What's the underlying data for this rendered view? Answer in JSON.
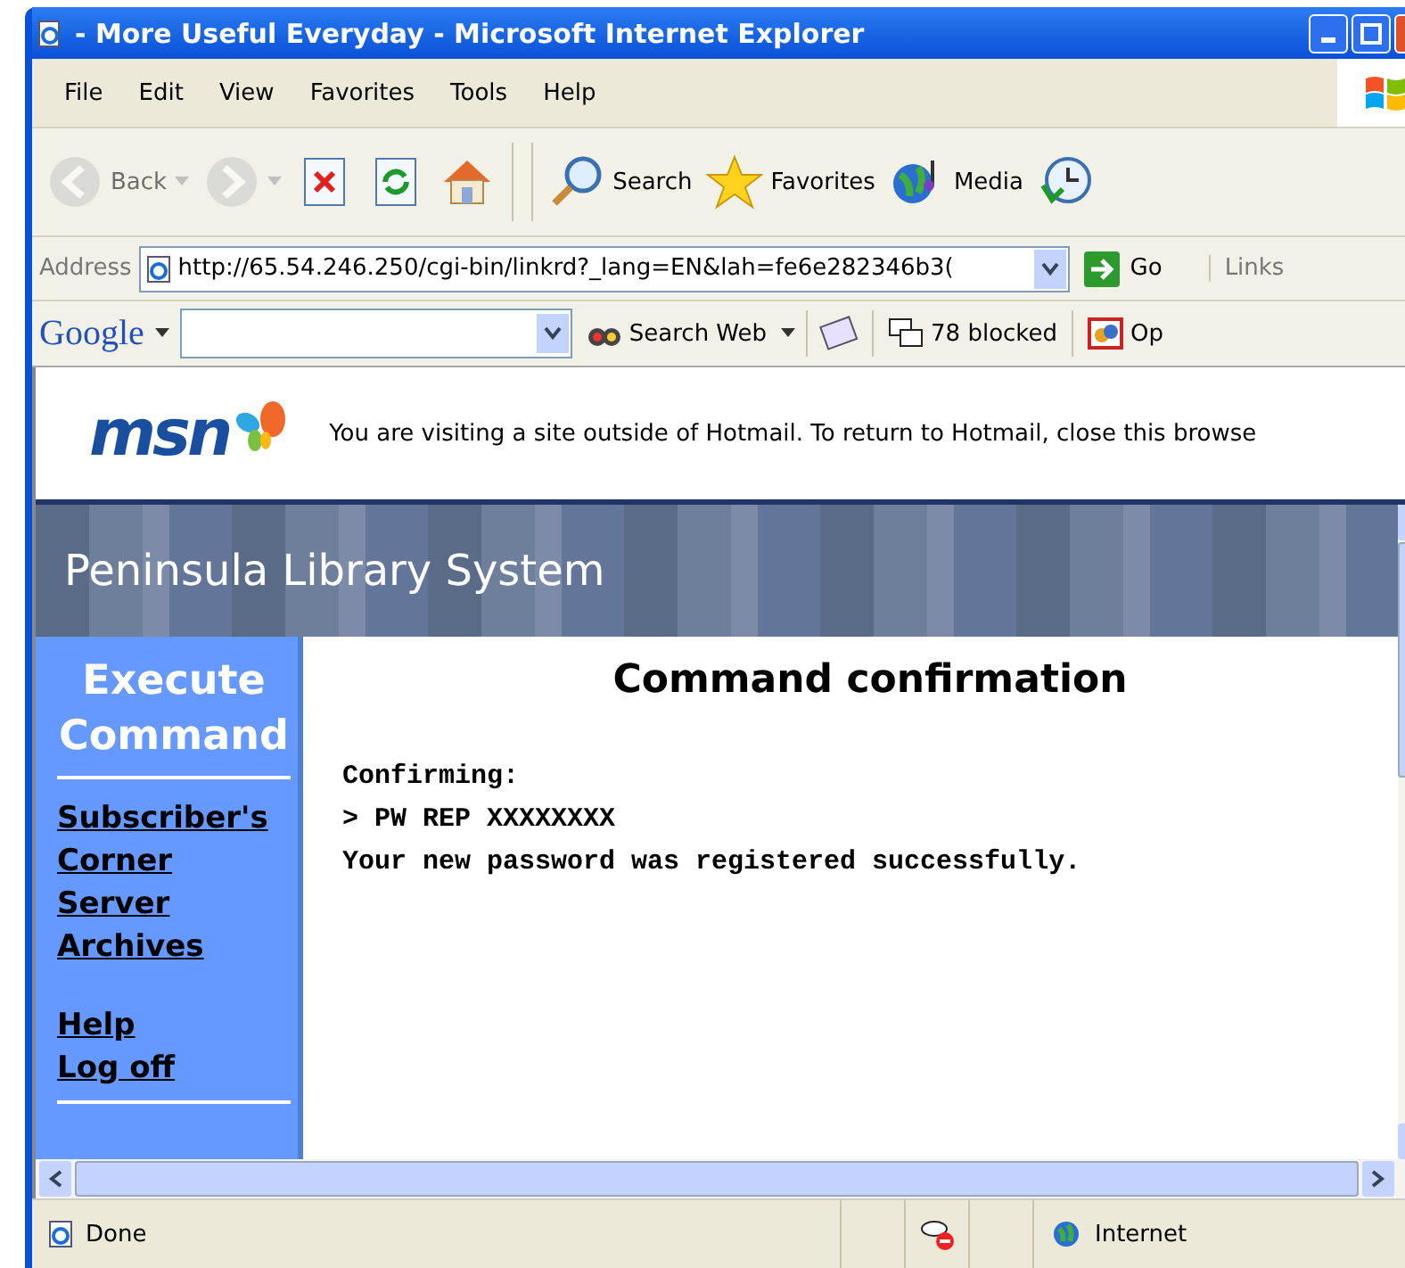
{
  "window": {
    "title": "- More Useful Everyday - Microsoft Internet Explorer"
  },
  "menu": [
    "File",
    "Edit",
    "View",
    "Favorites",
    "Tools",
    "Help"
  ],
  "toolbar": [
    {
      "kind": "back",
      "label": "Back",
      "disabled": true
    },
    {
      "kind": "forward",
      "disabled": true
    },
    {
      "kind": "stop",
      "disabled": false
    },
    {
      "kind": "refresh",
      "disabled": false
    },
    {
      "kind": "home",
      "disabled": false
    },
    {
      "kind": "search",
      "label": "Search",
      "disabled": false
    },
    {
      "kind": "favorites",
      "label": "Favorites",
      "disabled": false
    },
    {
      "kind": "media",
      "label": "Media",
      "disabled": false
    },
    {
      "kind": "history",
      "disabled": false
    }
  ],
  "address_bar": {
    "label": "Address",
    "url": "http://65.54.246.250/cgi-bin/linkrd?_lang=EN&lah=fe6e282346b3(",
    "go": "Go",
    "links": "Links"
  },
  "google_bar": {
    "logo": "Google",
    "search_button": "Search Web",
    "blocked": "78 blocked",
    "option": "Op"
  },
  "msn_banner": {
    "logo": "msn",
    "notice": "You are visiting a site outside of Hotmail. To return to Hotmail, close this browse"
  },
  "site": {
    "title": "Peninsula Library System"
  },
  "sidebar": {
    "heading": "Execute Command",
    "groups": [
      [
        "Subscriber's Corner",
        "Server Archives"
      ],
      [
        "Help",
        "Log off"
      ]
    ]
  },
  "main": {
    "title": "Command confirmation",
    "lines": [
      "Confirming:",
      "> PW REP XXXXXXXX",
      "Your new password was registered successfully."
    ]
  },
  "status_bar": {
    "text": "Done",
    "zone": "Internet"
  }
}
